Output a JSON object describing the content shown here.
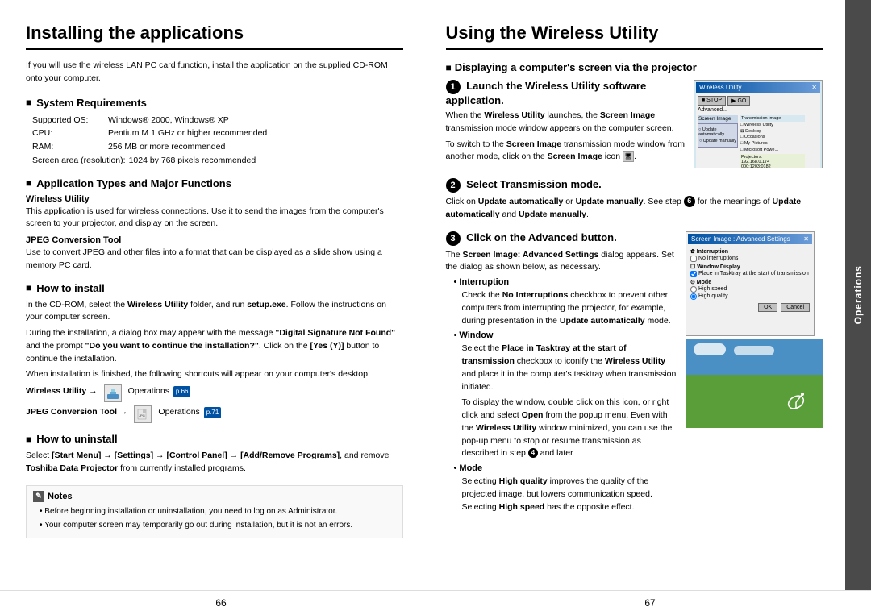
{
  "left": {
    "title": "Installing the applications",
    "intro": "If you will use the wireless LAN PC card function, install the application on the supplied CD-ROM onto your computer.",
    "sections": [
      {
        "id": "system-requirements",
        "title": "System Requirements",
        "specs": [
          {
            "label": "Supported OS:",
            "value": "Windows® 2000, Windows® XP"
          },
          {
            "label": "CPU:",
            "value": "Pentium M 1 GHz or higher recommended"
          },
          {
            "label": "RAM:",
            "value": "256 MB or more recommended"
          },
          {
            "label": "Screen area (resolution):",
            "value": "1024 by 768 pixels recommended"
          }
        ]
      },
      {
        "id": "application-types",
        "title": "Application Types and Major Functions",
        "subsections": [
          {
            "name": "Wireless Utility",
            "text": "This application is used for wireless connections. Use it to send the images from the computer's screen to your projector, and display on the screen."
          },
          {
            "name": "JPEG Conversion Tool",
            "text": "Use to convert JPEG and other files into a format that can be displayed as a slide show using a memory PC card."
          }
        ]
      },
      {
        "id": "how-to-install",
        "title": "How to install",
        "text1": "In the CD-ROM, select the Wireless Utility folder, and run setup.exe. Follow the instructions on your computer screen.",
        "text2": "During the installation, a dialog box may appear with the message \"Digital Signature Not Found\" and the prompt \"Do you want to continue the installation?\". Click on the [Yes (Y)] button to continue the installation.",
        "text3": "When installation is finished, the following shortcuts will appear on your computer's desktop:",
        "shortcuts": [
          {
            "label": "Wireless Utility →",
            "page": "p.66",
            "text": "Operations"
          },
          {
            "label": "JPEG Conversion Tool →",
            "page": "p.71",
            "text": "Operations"
          }
        ]
      },
      {
        "id": "how-to-uninstall",
        "title": "How to uninstall",
        "text": "Select [Start Menu] → [Settings] → [Control Panel] → [Add/Remove Programs], and remove Toshiba Data Projector from currently installed programs."
      },
      {
        "id": "notes",
        "title": "Notes",
        "items": [
          "Before beginning installation or uninstallation, you need to log on as Administrator.",
          "Your computer screen may temporarily go out during installation, but it is not an errors."
        ]
      }
    ],
    "page_number": "66"
  },
  "right": {
    "title": "Using the Wireless Utility",
    "display_section": "Displaying a computer's screen via the projector",
    "steps": [
      {
        "number": "1",
        "title": "Launch the Wireless Utility software application.",
        "text1": "When the Wireless Utility launches, the Screen Image transmission mode window appears on the computer screen.",
        "text2": "To switch to the Screen Image transmission mode window from another mode, click on the Screen Image icon",
        "has_screenshot": true
      },
      {
        "number": "2",
        "title": "Select Transmission mode.",
        "text1": "Click on Update automatically or Update manually. See step",
        "step_ref": "6",
        "text2": "for the meanings of Update automatically and Update manually."
      },
      {
        "number": "3",
        "title": "Click on the Advanced button.",
        "text1": "The Screen Image: Advanced Settings dialog appears. Set the dialog as shown below, as necessary.",
        "bullets": [
          {
            "heading": "Interruption",
            "text": "Check the No Interruptions checkbox to prevent other computers from interrupting the projector, for example, during presentation in the Update automatically mode."
          },
          {
            "heading": "Window",
            "text": "Select the Place in Tasktray at the start of transmission checkbox to iconify the Wireless Utility and place it in the computer's tasktray when transmission initiated.",
            "extra": "To display the window, double click on this icon, or right click and select Open from the popup menu. Even with the Wireless Utility window minimized, you can use the pop-up menu to stop or resume transmission as described in step"
          },
          {
            "heading": "Mode",
            "text": "Selecting High quality improves the quality of the projected image, but lowers communication speed. Selecting High speed has the opposite effect."
          }
        ],
        "has_advanced_screenshot": true
      }
    ],
    "page_number": "67",
    "operations_tab": "Operations"
  }
}
